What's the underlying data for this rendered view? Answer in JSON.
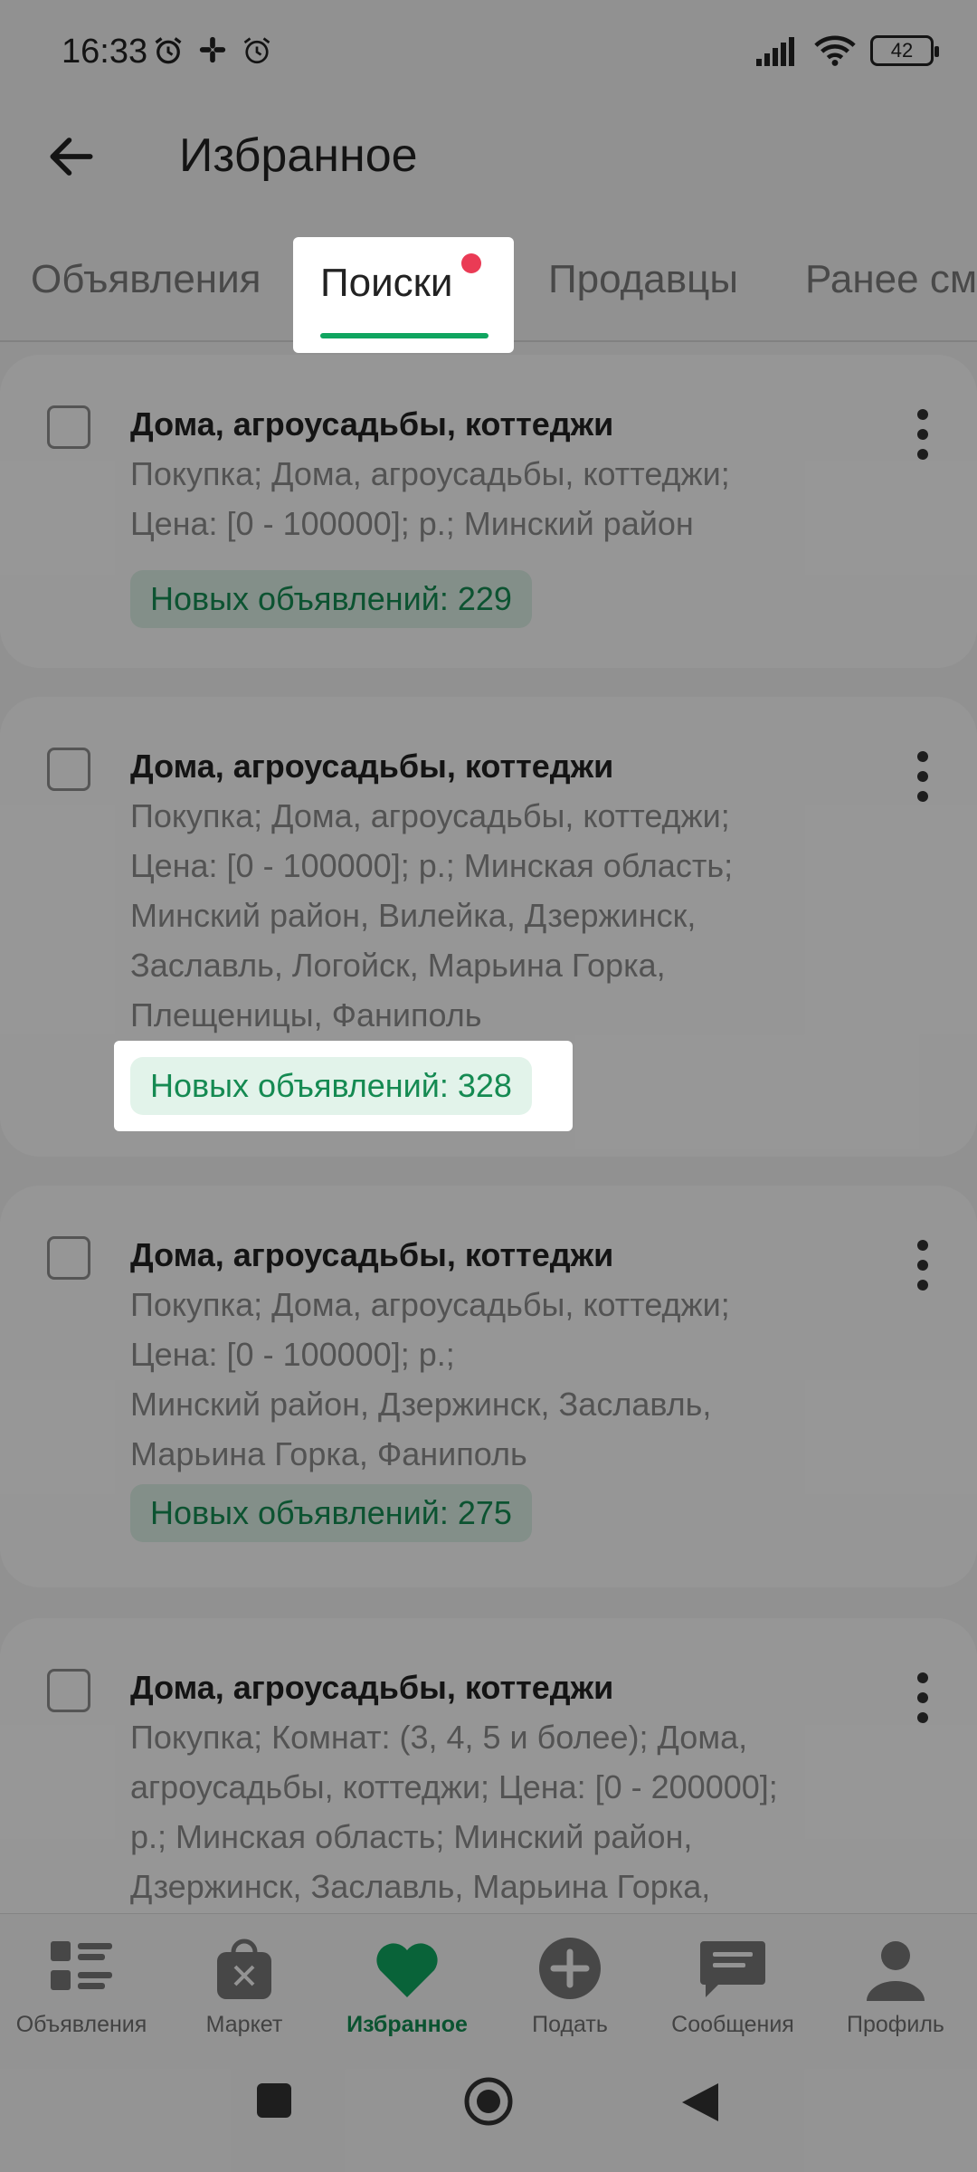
{
  "status_bar": {
    "time": "16:33",
    "left_icons": [
      "alarm-clock-icon",
      "slack-icon",
      "alarm-icon"
    ],
    "right_icons": [
      "signal-icon",
      "wifi-icon",
      "battery-icon"
    ],
    "battery_level": "42"
  },
  "app_bar": {
    "back_icon": "arrow-left-icon",
    "title": "Избранное"
  },
  "tabs": [
    {
      "label": "Объявления",
      "active": false
    },
    {
      "label": "Поиски",
      "active": true,
      "has_notification_dot": true
    },
    {
      "label": "Продавцы",
      "active": false
    },
    {
      "label": "Ранее см",
      "active": false
    }
  ],
  "saved_searches": [
    {
      "title": "Дома, агроусадьбы, коттеджи",
      "desc_lines": [
        "Покупка; Дома, агроусадьбы, коттеджи;",
        "Цена: [0 - 100000]; р.; Минский район"
      ],
      "badge": "Новых объявлений: 229",
      "checked": false
    },
    {
      "title": "Дома, агроусадьбы, коттеджи",
      "desc_lines": [
        "Покупка; Дома, агроусадьбы, коттеджи;",
        "Цена: [0 - 100000]; р.; Минская область;",
        "Минский район, Вилейка, Дзержинск,",
        "Заславль, Логойск, Марьина Горка,",
        "Плещеницы, Фаниполь"
      ],
      "badge": "Новых объявлений: 328",
      "checked": false,
      "highlighted": true
    },
    {
      "title": "Дома, агроусадьбы, коттеджи",
      "desc_lines": [
        "Покупка; Дома, агроусадьбы, коттеджи;",
        "Цена: [0 - 100000]; р.;",
        "Минский район, Дзержинск, Заславль,",
        "Марьина Горка, Фаниполь"
      ],
      "badge": "Новых объявлений: 275",
      "checked": false
    },
    {
      "title": "Дома, агроусадьбы, коттеджи",
      "desc_lines": [
        "Покупка; Комнат: (3, 4, 5 и более); Дома,",
        "агроусадьбы, коттеджи; Цена: [0 - 200000];",
        "р.; Минская область; Минский район,",
        "Дзержинск, Заславль, Марьина Горка,"
      ],
      "checked": false
    }
  ],
  "bottom_nav": [
    {
      "label": "Объявления",
      "icon": "list-icon",
      "active": false
    },
    {
      "label": "Маркет",
      "icon": "shopping-bag-icon",
      "active": false
    },
    {
      "label": "Избранное",
      "icon": "heart-icon",
      "active": true
    },
    {
      "label": "Подать",
      "icon": "plus-circle-icon",
      "active": false
    },
    {
      "label": "Сообщения",
      "icon": "message-icon",
      "active": false
    },
    {
      "label": "Профиль",
      "icon": "person-icon",
      "active": false
    }
  ],
  "system_nav": [
    "recents-button",
    "home-button",
    "back-button"
  ],
  "colors": {
    "accent_green": "#10a560",
    "badge_bg": "#dbeee4",
    "badge_text": "#158a52",
    "notification_dot": "#ea3b55"
  }
}
